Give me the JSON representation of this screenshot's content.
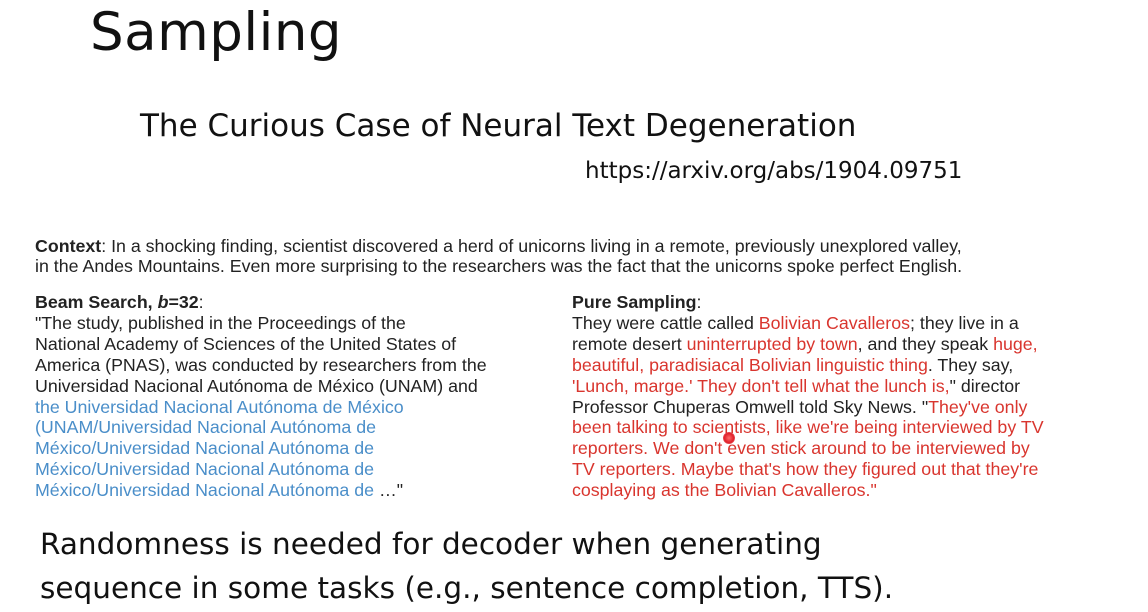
{
  "slide_title": "Sampling",
  "paper_title": "The Curious Case of Neural Text Degeneration",
  "paper_url": "https://arxiv.org/abs/1904.09751",
  "context": {
    "label": "Context",
    "line1": ": In a shocking finding, scientist discovered a herd of unicorns living in a remote, previously unexplored valley,",
    "line2": "in the Andes Mountains. Even more surprising to the researchers was the fact that the unicorns spoke perfect English."
  },
  "beam": {
    "header_prefix": "Beam Search, ",
    "header_b": "b",
    "header_suffix": "=32",
    "colon": ":",
    "lines": [
      "\"The study, published in the Proceedings of the",
      "National Academy of Sciences of the United States of",
      "America (PNAS), was conducted by researchers from the",
      "Universidad Nacional Autónoma de México (UNAM) and"
    ],
    "repeated_lines": [
      "the Universidad Nacional Autónoma de México",
      "(UNAM/Universidad Nacional Autónoma de",
      "México/Universidad Nacional Autónoma de",
      "México/Universidad Nacional Autónoma de",
      "México/Universidad Nacional Autónoma de"
    ],
    "ellipsis": " …\""
  },
  "sampling": {
    "header": "Pure Sampling",
    "colon": ":",
    "l1_a": "They were cattle called ",
    "l1_b": "Bolivian Cavalleros",
    "l1_c": "; they live in a",
    "l2_a": "remote desert ",
    "l2_b": "uninterrupted by town",
    "l2_c": ", and they speak ",
    "l2_d": "huge,",
    "l3_a": "beautiful, paradisiacal Bolivian linguistic thing",
    "l3_b": ". They say,",
    "l4_a": "'Lunch, marge.' They don't tell what the lunch is,",
    "l4_b": "\" director",
    "l5_a": "Professor Chuperas Omwell told Sky News. \"",
    "l5_b": "They've only",
    "l6": "been talking to scientists, like we're being interviewed by TV",
    "l7": "reporters. We don't even stick around to be interviewed by",
    "l8": "TV reporters. Maybe that's how they figured out that they're",
    "l9": "cosplaying as the Bolivian Cavalleros.\""
  },
  "takeaway": {
    "line1": "Randomness is needed for decoder when generating",
    "line2": "sequence in some tasks (e.g., sentence completion, TTS)."
  },
  "colors": {
    "repeat_blue": "#4a8ec9",
    "sample_red": "#d9352e",
    "laser": "#e0202a"
  }
}
